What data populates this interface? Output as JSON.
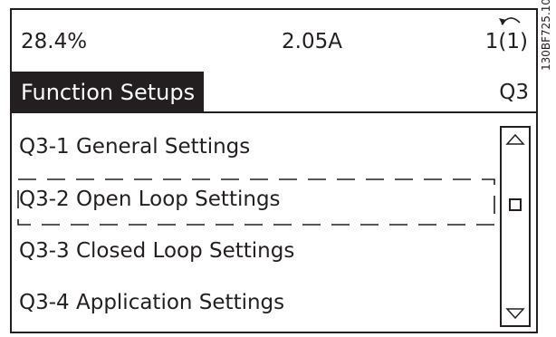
{
  "status": {
    "output_percent": "28.4%",
    "current": "2.05A",
    "setup": "1(1)"
  },
  "title": {
    "label": "Function Setups",
    "code": "Q3"
  },
  "menu": {
    "items": [
      {
        "label": "Q3-1 General Settings"
      },
      {
        "label": "Q3-2 Open Loop Settings"
      },
      {
        "label": "Q3-3 Closed Loop Settings"
      },
      {
        "label": "Q3-4 Application Settings"
      }
    ]
  },
  "doc_id": "130BF725.10",
  "icons": {
    "back": "back-arrow-icon",
    "scroll_up": "triangle-up-icon",
    "scroll_down": "triangle-down-icon"
  }
}
